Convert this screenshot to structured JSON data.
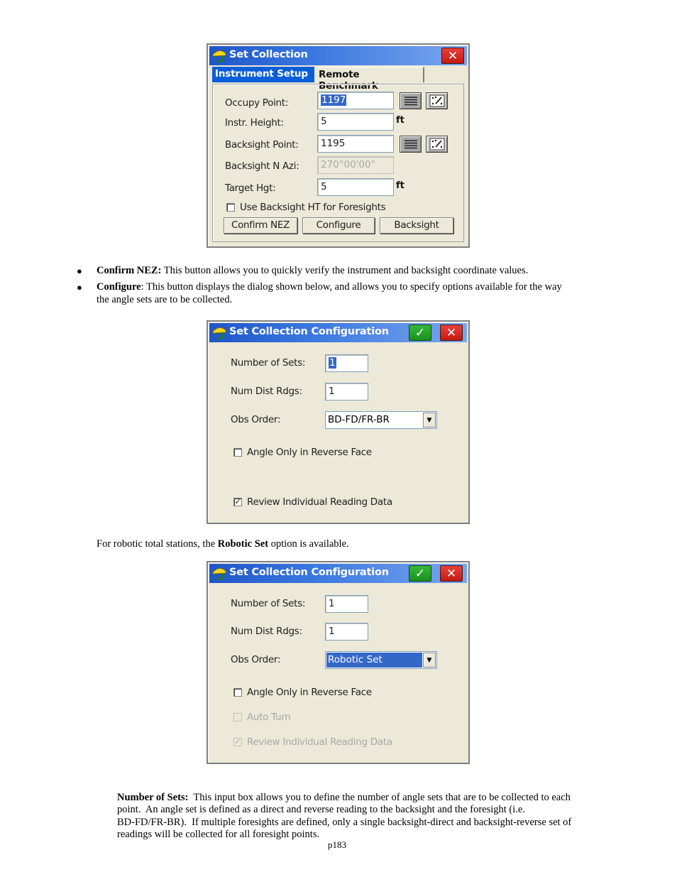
{
  "dialog1": {
    "title": "Set Collection",
    "tabs": [
      {
        "label": "Instrument Setup",
        "active": true
      },
      {
        "label": "Remote Benchmark",
        "active": false
      }
    ],
    "fields": {
      "occupy_point": {
        "label": "Occupy Point:",
        "value": "1197"
      },
      "instr_height": {
        "label": "Instr. Height:",
        "value": "5",
        "unit": "ft"
      },
      "backsight_point": {
        "label": "Backsight Point:",
        "value": "1195"
      },
      "backsight_azi": {
        "label": "Backsight N Azi:",
        "value": "270°00'00\""
      },
      "target_hgt": {
        "label": "Target Hgt:",
        "value": "5",
        "unit": "ft"
      }
    },
    "checkbox_use_backsight_ht": {
      "label": "Use Backsight HT for Foresights",
      "checked": false
    },
    "buttons": {
      "confirm": "Confirm NEZ",
      "configure": "Configure",
      "backsight": "Backsight"
    },
    "icons": {
      "list": "list-icon",
      "map": "map-select-icon",
      "close": "close-icon"
    }
  },
  "bullets": [
    {
      "term": "Confirm NEZ:",
      "text": " This button allows you to quickly verify the instrument and backsight coordinate values."
    },
    {
      "term": "Configure",
      "text": ": This button displays the dialog shown below, and allows you to specify options available for the way",
      "text2": "the angle sets are to be collected."
    }
  ],
  "dialog2": {
    "title": "Set Collection Configuration",
    "number_of_sets": {
      "label": "Number of Sets:",
      "value": "1"
    },
    "num_dist_rdgs": {
      "label": "Num Dist Rdgs:",
      "value": "1"
    },
    "obs_order": {
      "label": "Obs Order:",
      "value": "BD-FD/FR-BR"
    },
    "angle_only_reverse": {
      "label": "Angle Only in Reverse Face",
      "checked": false
    },
    "review_individual": {
      "label": "Review Individual Reading Data",
      "checked": true
    }
  },
  "robotic_note": {
    "pre": "For robotic total stations, the ",
    "bold": "Robotic  Set",
    "post": " option is available."
  },
  "dialog3": {
    "title": "Set Collection Configuration",
    "number_of_sets": {
      "label": "Number of Sets:",
      "value": "1"
    },
    "num_dist_rdgs": {
      "label": "Num Dist Rdgs:",
      "value": "1"
    },
    "obs_order": {
      "label": "Obs Order:",
      "value": "Robotic Set"
    },
    "angle_only_reverse": {
      "label": "Angle Only in Reverse Face",
      "checked": false
    },
    "auto_turn": {
      "label": "Auto Turn",
      "checked": false,
      "disabled": true
    },
    "review_individual": {
      "label": "Review Individual Reading Data",
      "checked": true,
      "disabled": true
    }
  },
  "number_of_sets_para": {
    "term": "Number of Sets:",
    "lines": [
      "  This input box allows you to define the number of angle sets that are to be collected to each",
      "point.  An angle set is defined as a direct and reverse reading to the backsight and the foresight (i.e.",
      "BD-FD/FR-BR).  If multiple foresights are defined, only a single backsight-direct and backsight-reverse set of",
      "readings will be collected for all foresight points."
    ]
  },
  "page_number": "p183"
}
